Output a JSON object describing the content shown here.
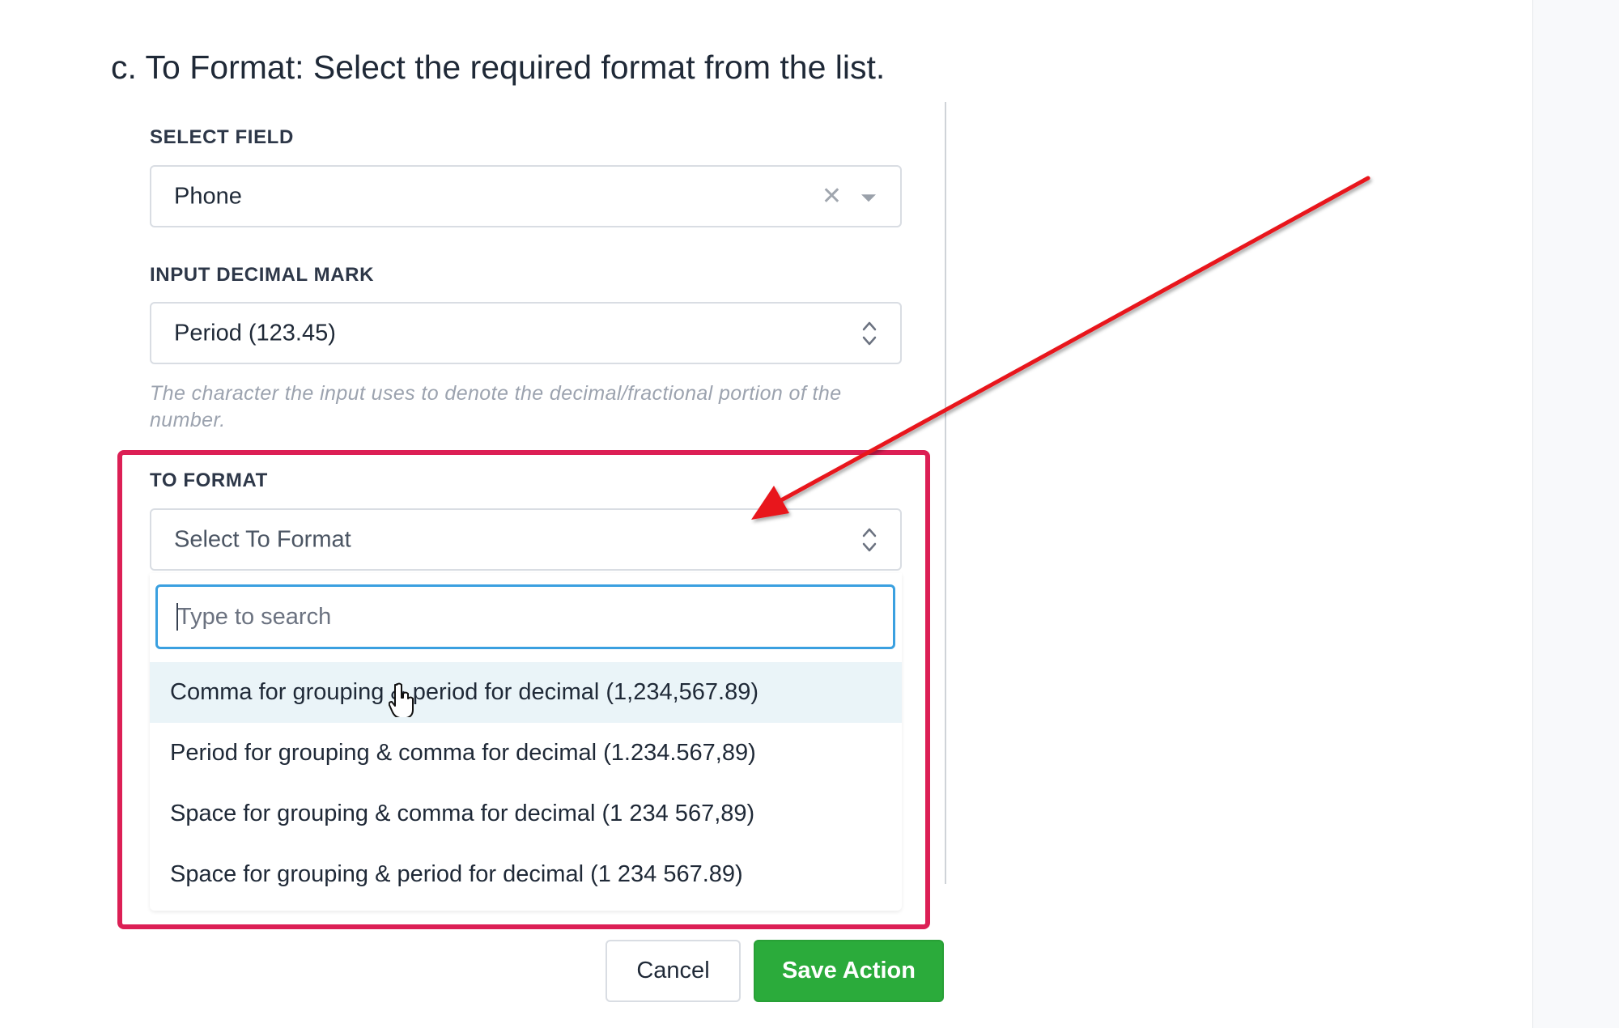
{
  "instruction": "c. To Format: Select the required format from the list.",
  "select_field": {
    "label": "SELECT FIELD",
    "value": "Phone",
    "clear_icon": "close-icon",
    "caret_icon": "chevron-down-icon"
  },
  "input_decimal_mark": {
    "label": "INPUT DECIMAL MARK",
    "value": "Period (123.45)",
    "help": "The character the input uses to denote the decimal/fractional portion of the number.",
    "caret_icon": "chevron-updown-icon"
  },
  "to_format": {
    "label": "TO FORMAT",
    "placeholder": "Select To Format",
    "caret_icon": "chevron-updown-icon",
    "search_placeholder": "Type to search",
    "options": [
      "Comma for grouping & period for decimal (1,234,567.89)",
      "Period for grouping & comma for decimal (1.234.567,89)",
      "Space for grouping & comma for decimal (1 234 567,89)",
      "Space for grouping & period for decimal (1 234 567.89)"
    ],
    "hovered_option_index": 0
  },
  "buttons": {
    "cancel": "Cancel",
    "save": "Save Action"
  },
  "colors": {
    "highlight_border": "#dc1f55",
    "annotation_arrow": "#e8161f",
    "save_button": "#2bab3b",
    "search_focus": "#3aa0e0",
    "hover_option": "#eaf4f8"
  }
}
